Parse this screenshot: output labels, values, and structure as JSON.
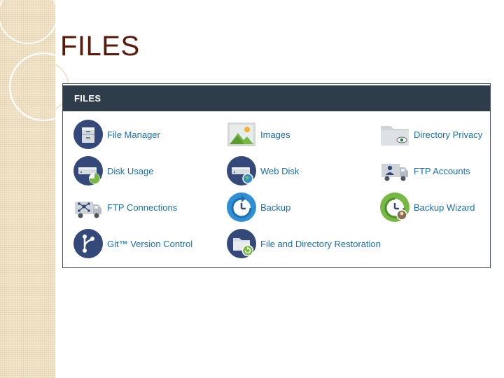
{
  "slide": {
    "title": "FILES"
  },
  "panel": {
    "header": "FILES",
    "items": [
      {
        "label": "File Manager",
        "icon": "file-cabinet-icon"
      },
      {
        "label": "Images",
        "icon": "picture-icon"
      },
      {
        "label": "Directory Privacy",
        "icon": "folder-eye-icon"
      },
      {
        "label": "Disk Usage",
        "icon": "disk-pie-icon"
      },
      {
        "label": "Web Disk",
        "icon": "disk-globe-icon"
      },
      {
        "label": "FTP Accounts",
        "icon": "truck-user-icon"
      },
      {
        "label": "FTP Connections",
        "icon": "truck-network-icon"
      },
      {
        "label": "Backup",
        "icon": "backup-clock-icon"
      },
      {
        "label": "Backup Wizard",
        "icon": "backup-wizard-icon"
      },
      {
        "label": "Git™ Version Control",
        "icon": "git-branch-icon"
      },
      {
        "label": "File and Directory Restoration",
        "icon": "folder-restore-icon"
      }
    ]
  },
  "colors": {
    "title": "#5a1a0a",
    "header_bg": "#2f3d4b",
    "link": "#1b6ea8",
    "navy": "#34497a",
    "blue": "#2f8fd4",
    "green": "#76b843",
    "gray": "#cfd4d8"
  }
}
